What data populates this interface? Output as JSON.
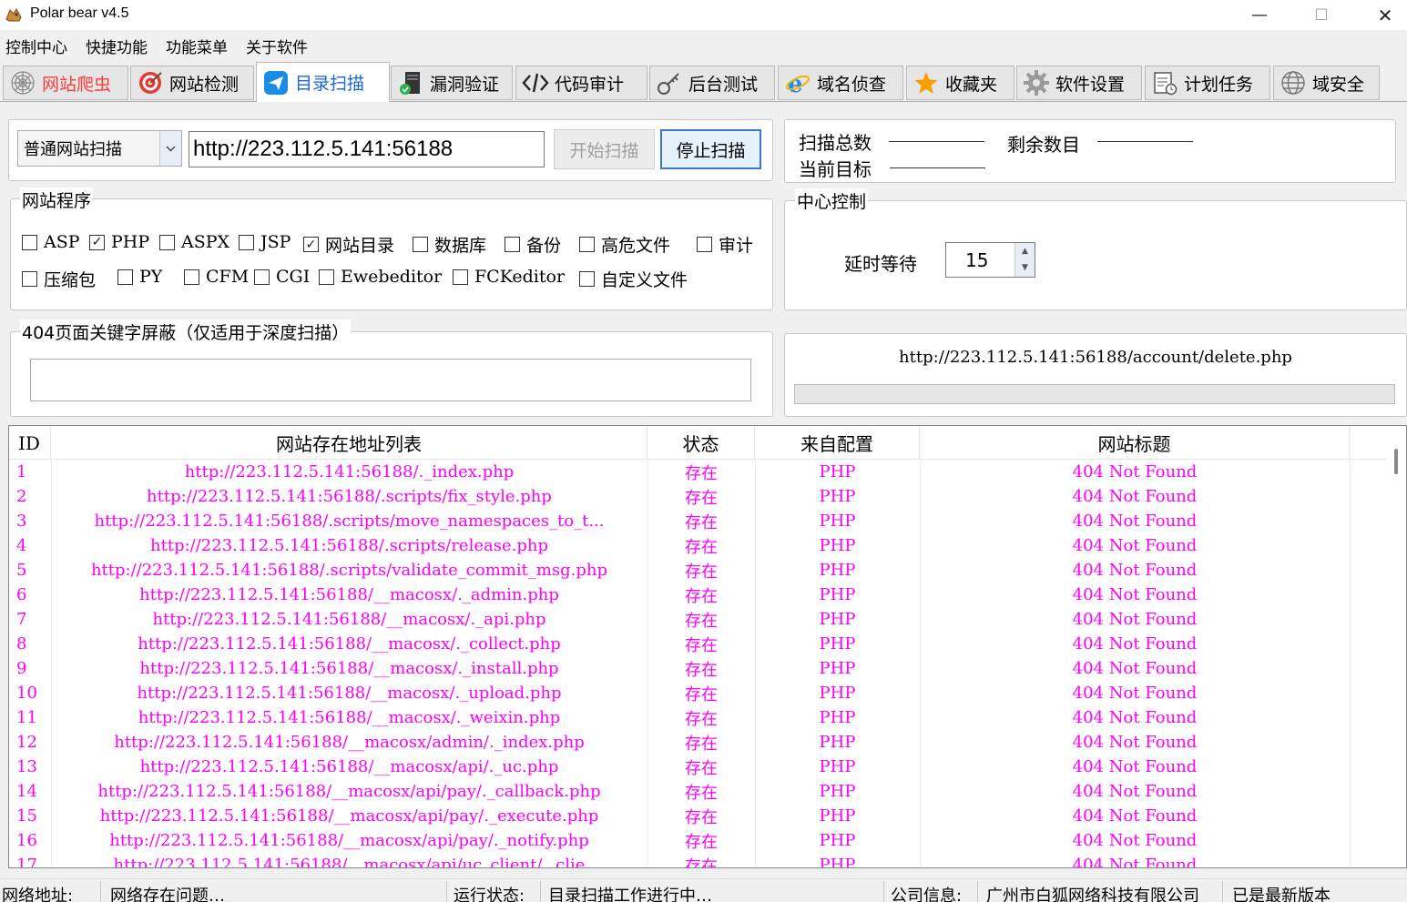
{
  "window": {
    "title": "Polar bear v4.5",
    "minimize": "—",
    "maximize": "☐",
    "close": "✕"
  },
  "menu": [
    "控制中心",
    "快捷功能",
    "功能菜单",
    "关于软件"
  ],
  "tabs": [
    {
      "label": "网站爬虫",
      "icon": "spider-web-icon",
      "color": "#ff3b3b"
    },
    {
      "label": "网站检测",
      "icon": "target-icon"
    },
    {
      "label": "目录扫描",
      "icon": "paper-plane-icon",
      "color": "#1a66d6",
      "active": true
    },
    {
      "label": "漏洞验证",
      "icon": "server-shield-icon"
    },
    {
      "label": "代码审计",
      "icon": "code-icon"
    },
    {
      "label": "后台测试",
      "icon": "key-icon"
    },
    {
      "label": "域名侦查",
      "icon": "ie-icon"
    },
    {
      "label": "收藏夹",
      "icon": "star-icon"
    },
    {
      "label": "软件设置",
      "icon": "gear-icon"
    },
    {
      "label": "计划任务",
      "icon": "schedule-icon"
    },
    {
      "label": "域安全",
      "icon": "globe-icon"
    }
  ],
  "scan": {
    "mode": "普通网站扫描",
    "url": "http://223.112.5.141:56188",
    "start_label": "开始扫描",
    "stop_label": "停止扫描"
  },
  "stats": {
    "total_label": "扫描总数",
    "remaining_label": "剩余数目",
    "current_label": "当前目标"
  },
  "program": {
    "title": "网站程序",
    "options": [
      {
        "label": "ASP",
        "checked": false
      },
      {
        "label": "PHP",
        "checked": true
      },
      {
        "label": "ASPX",
        "checked": false
      },
      {
        "label": "JSP",
        "checked": false
      },
      {
        "label": "网站目录",
        "checked": true
      },
      {
        "label": "数据库",
        "checked": false
      },
      {
        "label": "备份",
        "checked": false
      },
      {
        "label": "高危文件",
        "checked": false
      },
      {
        "label": "审计",
        "checked": false
      },
      {
        "label": "压缩包",
        "checked": false
      },
      {
        "label": "PY",
        "checked": false
      },
      {
        "label": "CFM",
        "checked": false
      },
      {
        "label": "CGI",
        "checked": false
      },
      {
        "label": "Ewebeditor",
        "checked": false
      },
      {
        "label": "FCKeditor",
        "checked": false
      },
      {
        "label": "自定义文件",
        "checked": false
      }
    ]
  },
  "control": {
    "title": "中心控制",
    "delay_label": "延时等待",
    "delay_value": "15"
  },
  "keyword": {
    "title": "404页面关键字屏蔽（仅适用于深度扫描）",
    "value": ""
  },
  "current": {
    "path": "http://223.112.5.141:56188/account/delete.php",
    "progress": 0
  },
  "table": {
    "columns": [
      "ID",
      "网站存在地址列表",
      "状态",
      "来自配置",
      "网站标题"
    ],
    "rows": [
      [
        "1",
        "http://223.112.5.141:56188/._index.php",
        "存在",
        "PHP",
        "404 Not Found"
      ],
      [
        "2",
        "http://223.112.5.141:56188/.scripts/fix_style.php",
        "存在",
        "PHP",
        "404 Not Found"
      ],
      [
        "3",
        "http://223.112.5.141:56188/.scripts/move_namespaces_to_t...",
        "存在",
        "PHP",
        "404 Not Found"
      ],
      [
        "4",
        "http://223.112.5.141:56188/.scripts/release.php",
        "存在",
        "PHP",
        "404 Not Found"
      ],
      [
        "5",
        "http://223.112.5.141:56188/.scripts/validate_commit_msg.php",
        "存在",
        "PHP",
        "404 Not Found"
      ],
      [
        "6",
        "http://223.112.5.141:56188/__macosx/._admin.php",
        "存在",
        "PHP",
        "404 Not Found"
      ],
      [
        "7",
        "http://223.112.5.141:56188/__macosx/._api.php",
        "存在",
        "PHP",
        "404 Not Found"
      ],
      [
        "8",
        "http://223.112.5.141:56188/__macosx/._collect.php",
        "存在",
        "PHP",
        "404 Not Found"
      ],
      [
        "9",
        "http://223.112.5.141:56188/__macosx/._install.php",
        "存在",
        "PHP",
        "404 Not Found"
      ],
      [
        "10",
        "http://223.112.5.141:56188/__macosx/._upload.php",
        "存在",
        "PHP",
        "404 Not Found"
      ],
      [
        "11",
        "http://223.112.5.141:56188/__macosx/._weixin.php",
        "存在",
        "PHP",
        "404 Not Found"
      ],
      [
        "12",
        "http://223.112.5.141:56188/__macosx/admin/._index.php",
        "存在",
        "PHP",
        "404 Not Found"
      ],
      [
        "13",
        "http://223.112.5.141:56188/__macosx/api/._uc.php",
        "存在",
        "PHP",
        "404 Not Found"
      ],
      [
        "14",
        "http://223.112.5.141:56188/__macosx/api/pay/._callback.php",
        "存在",
        "PHP",
        "404 Not Found"
      ],
      [
        "15",
        "http://223.112.5.141:56188/__macosx/api/pay/._execute.php",
        "存在",
        "PHP",
        "404 Not Found"
      ],
      [
        "16",
        "http://223.112.5.141:56188/__macosx/api/pay/._notify.php",
        "存在",
        "PHP",
        "404 Not Found"
      ],
      [
        "17",
        "http://223.112.5.141:56188/__macosx/api/uc_client/._clie",
        "存在",
        "PHP",
        "404 Not Found"
      ]
    ]
  },
  "status": {
    "net_label": "网络地址:",
    "net_value": "网络存在问题…",
    "run_label": "运行状态:",
    "run_value": "目录扫描工作进行中…",
    "company_label": "公司信息:",
    "company_value": "广州市白狐网络科技有限公司",
    "version": "已是最新版本"
  },
  "colors": {
    "row_text": "#ff00ff",
    "active_tab": "#1a66d6",
    "first_tab": "#ff3b3b"
  }
}
